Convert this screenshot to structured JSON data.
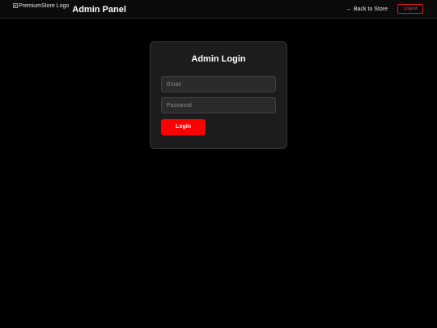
{
  "header": {
    "logo_alt": "PremiumStore Logo",
    "title": "Admin Panel",
    "back_link": "Back to Store",
    "back_icon": "arrow-left-icon",
    "logout_label": "Logout"
  },
  "login": {
    "title": "Admin Login",
    "email_placeholder": "Email",
    "password_placeholder": "Password",
    "submit_label": "Login"
  },
  "colors": {
    "background": "#000000",
    "card": "#1c1c1c",
    "accent": "#ff0000"
  }
}
